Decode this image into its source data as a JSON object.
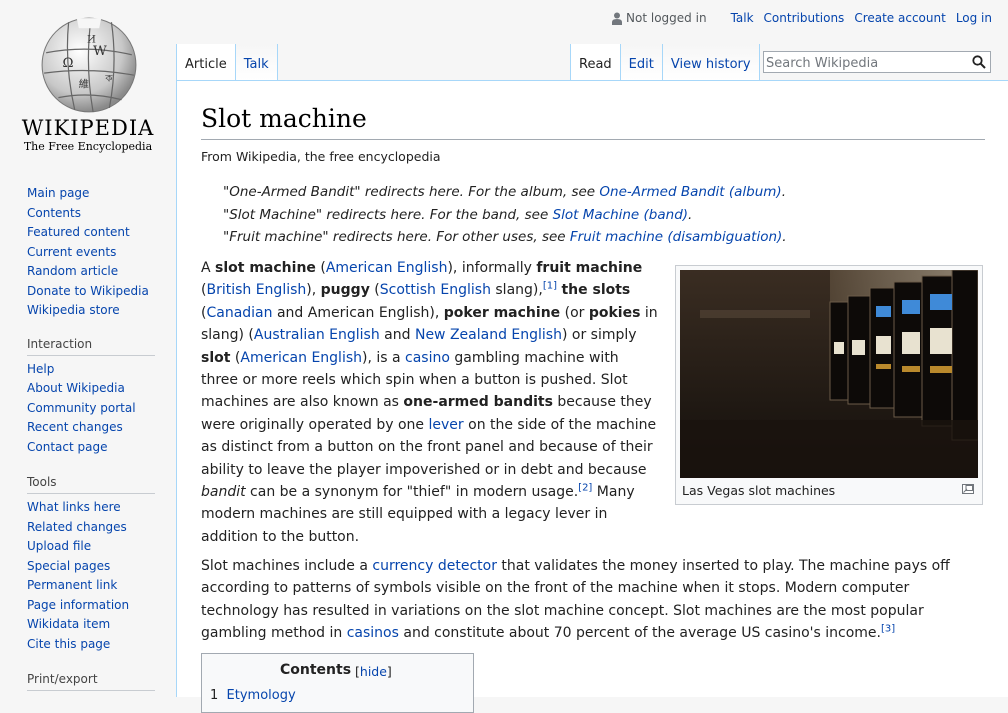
{
  "logo": {
    "wordmark": "WIKIPEDIA",
    "tagline": "The Free Encyclopedia"
  },
  "personal": {
    "not_logged_in": "Not logged in",
    "talk": "Talk",
    "contributions": "Contributions",
    "create_account": "Create account",
    "log_in": "Log in"
  },
  "tabs": {
    "article": "Article",
    "talk": "Talk",
    "read": "Read",
    "edit": "Edit",
    "view_history": "View history"
  },
  "search": {
    "placeholder": "Search Wikipedia"
  },
  "sidebar": {
    "navigation": [
      "Main page",
      "Contents",
      "Featured content",
      "Current events",
      "Random article",
      "Donate to Wikipedia",
      "Wikipedia store"
    ],
    "interaction_heading": "Interaction",
    "interaction": [
      "Help",
      "About Wikipedia",
      "Community portal",
      "Recent changes",
      "Contact page"
    ],
    "tools_heading": "Tools",
    "tools": [
      "What links here",
      "Related changes",
      "Upload file",
      "Special pages",
      "Permanent link",
      "Page information",
      "Wikidata item",
      "Cite this page"
    ],
    "print_heading": "Print/export"
  },
  "article": {
    "title": "Slot machine",
    "site_sub": "From Wikipedia, the free encyclopedia",
    "hatnotes": [
      {
        "text": "\"One-Armed Bandit\" redirects here. For the album, see ",
        "link": "One-Armed Bandit (album)",
        "end": "."
      },
      {
        "text": "\"Slot Machine\" redirects here. For the band, see ",
        "link": "Slot Machine (band)",
        "end": "."
      },
      {
        "text": "\"Fruit machine\" redirects here. For other uses, see ",
        "link": "Fruit machine (disambiguation)",
        "end": "."
      }
    ],
    "p1": {
      "a": "A ",
      "b1": "slot machine",
      "c": " (",
      "l1": "American English",
      "d": "), informally ",
      "b2": "fruit machine",
      "e": " (",
      "l2": "British English",
      "f": "), ",
      "b3": "puggy",
      "g": " (",
      "l3": "Scottish English",
      "h": " slang),",
      "r1": "[1]",
      "i": " ",
      "b4": "the slots",
      "j": " (",
      "l4": "Canadian",
      "k": " and American English), ",
      "b5": "poker machine",
      "m": " (or ",
      "b6": "pokies",
      "n": " in slang) (",
      "l5": "Australian English",
      "o": " and ",
      "l6": "New Zealand English",
      "p": ") or simply ",
      "b7": "slot",
      "q": " (",
      "l7": "American English",
      "r": "), is a ",
      "l8": "casino",
      "s": " gambling machine with three or more reels which spin when a button is pushed. Slot machines are also known as ",
      "b8": "one-armed bandits",
      "t": " because they were originally operated by one ",
      "l9": "lever",
      "u": " on the side of the machine as distinct from a button on the front panel and because of their ability to leave the player impoverished or in debt and because ",
      "it": "bandit",
      "v": " can be a synonym for \"thief\" in modern usage.",
      "r2": "[2]",
      "w": " Many modern machines are still equipped with a legacy lever in addition to the button."
    },
    "p2": {
      "a": "Slot machines include a ",
      "l1": "currency detector",
      "b": " that validates the money inserted to play. The machine pays off according to patterns of symbols visible on the front of the machine when it stops. Modern computer technology has resulted in variations on the slot machine concept. Slot machines are the most popular gambling method in ",
      "l2": "casinos",
      "c": " and constitute about 70 percent of the average US casino's income.",
      "r3": "[3]"
    },
    "thumb_caption": "Las Vegas slot machines"
  },
  "toc": {
    "title": "Contents",
    "toggle": "hide",
    "first_num": "1",
    "first_item": "Etymology"
  }
}
